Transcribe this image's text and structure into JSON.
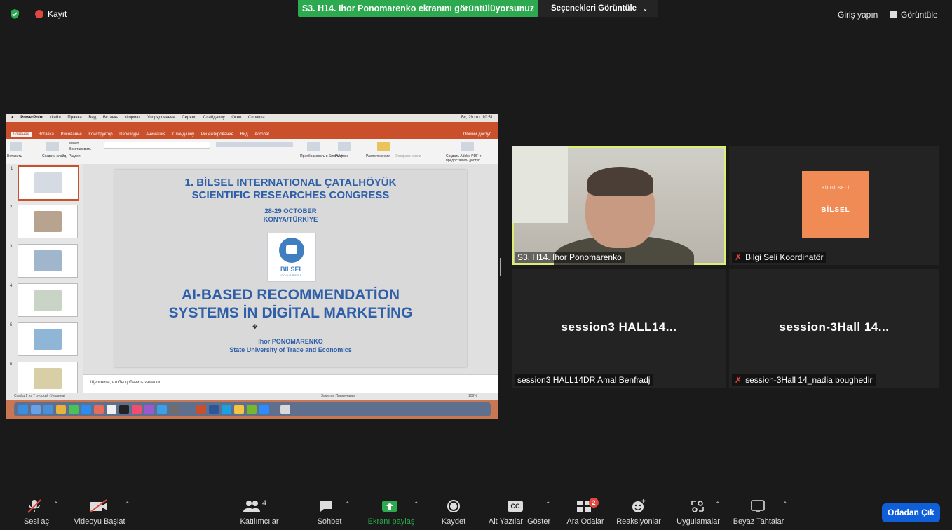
{
  "top": {
    "record_label": "Kayıt",
    "share_banner": "S3. H14. Ihor Ponomarenko ekranını görüntülüyorsunuz",
    "view_options": "Seçenekleri Görüntüle",
    "signin": "Giriş yapın",
    "view": "Görüntüle"
  },
  "ppt": {
    "menubar": [
      "PowerPoint",
      "Файл",
      "Правка",
      "Вид",
      "Вставка",
      "Формат",
      "Упорядочение",
      "Сервис",
      "Слайд-шоу",
      "Окно",
      "Справка"
    ],
    "menubar_right": "Вс, 29 окт. 10:51",
    "tabs": [
      "Главная",
      "Вставка",
      "Рисование",
      "Конструктор",
      "Переходы",
      "Анимация",
      "Слайд-шоу",
      "Рецензирование",
      "Вид",
      "Acrobat"
    ],
    "share_btn": "Общий доступ",
    "ribbon_labels": [
      "Вставить",
      "Создать слайд",
      "Макет",
      "Восстановить",
      "Раздел",
      "Преобразовать в SmartArt",
      "Рисунок",
      "Расположение",
      "Экспресс-стили",
      "Создать Adobe PDF и предоставить доступ"
    ],
    "slide": {
      "title1": "1. BİLSEL INTERNATIONAL ÇATALHÖYÜK",
      "title2": "SCIENTIFIC RESEARCHES CONGRESS",
      "date1": "28-29 OCTOBER",
      "date2": "KONYA/TÜRKİYE",
      "logo": "BİLSEL",
      "logo_sub": "CONGRESS",
      "main1": "AI-BASED RECOMMENDATİON",
      "main2": "SYSTEMS İN DİGİTAL MARKETİNG",
      "author": "Ihor PONOMARENKO",
      "org": "State University of Trade and Economics"
    },
    "notes": "Щелкните, чтобы добавить заметки",
    "status_left": "Слайд 1 из 7   русский (Украина)",
    "status_right": "Заметки   Примечания",
    "zoom": "109%",
    "thumb_numbers": [
      "1",
      "2",
      "3",
      "4",
      "5",
      "6"
    ]
  },
  "tiles": {
    "speaker": "S3. H14. Ihor Ponomarenko",
    "logo_name": "Bilgi Seli Koordinatör",
    "logo_t1": "BİLGİ SELİ",
    "logo_t2": "BİLSEL",
    "t3_big": "session3 HALL14...",
    "t3_name": "session3 HALL14DR Amal Benfradj",
    "t4_big": "session-3Hall 14...",
    "t4_name": "session-3Hall 14_nadia boughedir"
  },
  "toolbar": {
    "audio": "Sesi aç",
    "video": "Videoyu Başlat",
    "participants": "Katılımcılar",
    "participants_count": "4",
    "chat": "Sohbet",
    "share": "Ekranı paylaş",
    "record": "Kaydet",
    "captions": "Alt Yazıları Göster",
    "captions_icon": "CC",
    "breakout": "Ara Odalar",
    "breakout_badge": "2",
    "reactions": "Reaksiyonlar",
    "apps": "Uygulamalar",
    "whiteboard": "Beyaz Tahtalar",
    "leave": "Odadan Çık"
  },
  "colors": {
    "share_green": "#2da94f",
    "leave_blue": "#0e5fd8",
    "active_outline": "#ddee77",
    "ppt_orange": "#c9502a"
  }
}
